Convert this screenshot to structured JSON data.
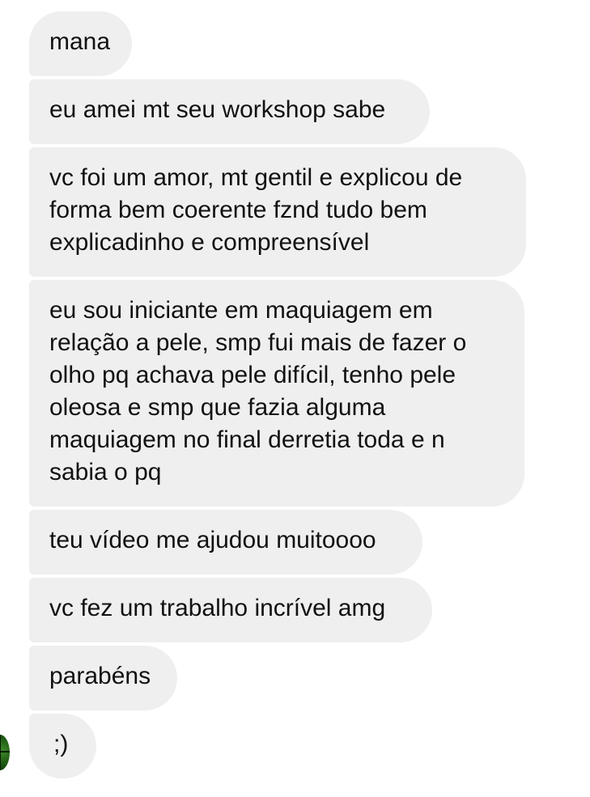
{
  "messages": [
    {
      "text": "mana"
    },
    {
      "text": "eu amei mt seu workshop sabe"
    },
    {
      "text": "vc foi um amor, mt gentil e explicou de forma bem coerente fznd tudo bem explicadinho e compreensível"
    },
    {
      "text": "eu sou iniciante em maquiagem em relação a pele, smp fui mais de fazer o olho pq achava pele difícil, tenho pele oleosa e smp que fazia alguma maquiagem no final derretia toda e n sabia o pq"
    },
    {
      "text": "teu vídeo me ajudou muitoooo"
    },
    {
      "text": "vc fez um trabalho incrível amg"
    },
    {
      "text": "parabéns"
    },
    {
      "text": ";)"
    }
  ],
  "colors": {
    "bubble": "#efefef",
    "text": "#111111",
    "background": "#ffffff"
  }
}
